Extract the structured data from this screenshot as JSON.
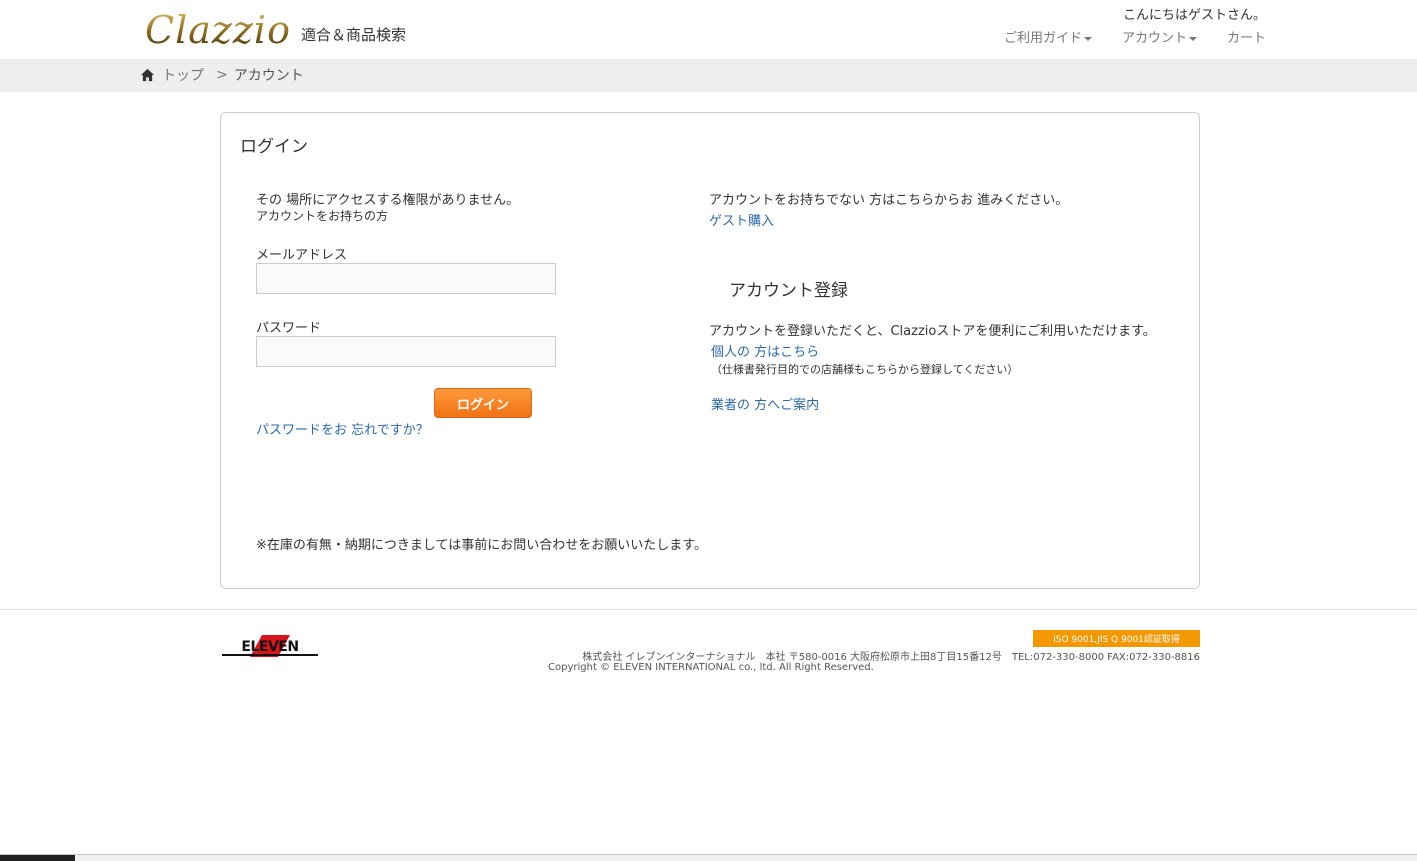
{
  "header": {
    "logo_text": "Clazzio",
    "logo_sub": "適合＆商品検索",
    "greeting": "こんにちはゲストさん。",
    "nav": {
      "guide": "ご利用ガイド",
      "account": "アカウント",
      "cart": "カート"
    }
  },
  "breadcrumb": {
    "home": "トップ",
    "separator": ">",
    "current": "アカウント"
  },
  "login": {
    "title": "ログイン",
    "no_access_msg": "その 場所にアクセスする権限がありません。",
    "has_account_msg": "アカウントをお持ちの方",
    "email_label": "メールアドレス",
    "email_value": "",
    "password_label": "パスワード",
    "password_value": "",
    "submit_label": "ログイン",
    "forgot_link": "パスワードをお 忘れですか？"
  },
  "guest": {
    "message": "アカウントをお持ちでない 方はこちらからお 進みください。",
    "link": "ゲスト購入"
  },
  "register": {
    "title": "アカウント登録",
    "message": "アカウントを登録いただくと、Clazzioストアを便利にご利用いただけます。",
    "personal_link": "個人の 方はこちら",
    "personal_note": "（仕様書発行目的での店舗様もこちらから登録してください）",
    "business_link": "業者の 方へご案内"
  },
  "notice": "※在庫の有無・納期につきましては事前にお問い合わせをお願いいたします。",
  "footer": {
    "logo_text": "ELEVEN",
    "iso_badge": "ISO 9001,JIS Q 9001認証取得",
    "company_info": "株式会社 イレブンインターナショナル　本社 〒580-0016 大阪府松原市上田8丁目15番12号　TEL:072-330-8000 FAX:072-330-8816",
    "copyright": "Copyright © ELEVEN INTERNATIONAL co., ltd. All Right Reserved."
  },
  "colors": {
    "accent_orange": "#f07214",
    "link_blue": "#2a6aad",
    "iso_orange": "#f39800",
    "logo_gold": "#b8922e"
  },
  "icons": {
    "home": "home-icon",
    "caret": "caret-down-icon"
  }
}
